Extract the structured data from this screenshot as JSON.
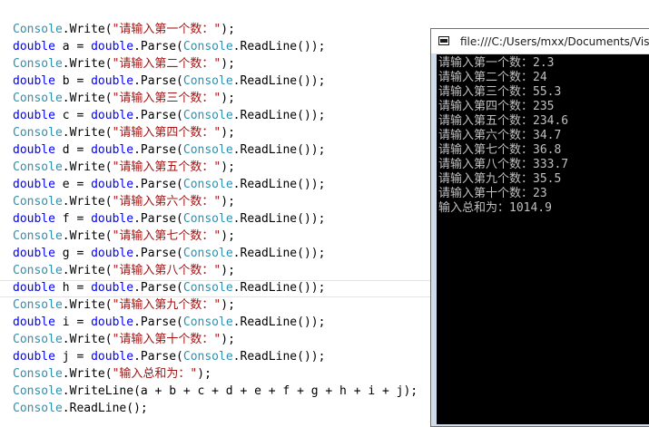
{
  "editor": {
    "lines": [
      [
        {
          "t": "cls",
          "v": "Console"
        },
        {
          "t": "plain",
          "v": ".Write("
        },
        {
          "t": "str",
          "v": "\"请输入第一个数：\""
        },
        {
          "t": "plain",
          "v": ");"
        }
      ],
      [
        {
          "t": "kw",
          "v": "double"
        },
        {
          "t": "plain",
          "v": " a = "
        },
        {
          "t": "kw",
          "v": "double"
        },
        {
          "t": "plain",
          "v": ".Parse("
        },
        {
          "t": "cls",
          "v": "Console"
        },
        {
          "t": "plain",
          "v": ".ReadLine());"
        }
      ],
      [
        {
          "t": "cls",
          "v": "Console"
        },
        {
          "t": "plain",
          "v": ".Write("
        },
        {
          "t": "str",
          "v": "\"请输入第二个数：\""
        },
        {
          "t": "plain",
          "v": ");"
        }
      ],
      [
        {
          "t": "kw",
          "v": "double"
        },
        {
          "t": "plain",
          "v": " b = "
        },
        {
          "t": "kw",
          "v": "double"
        },
        {
          "t": "plain",
          "v": ".Parse("
        },
        {
          "t": "cls",
          "v": "Console"
        },
        {
          "t": "plain",
          "v": ".ReadLine());"
        }
      ],
      [
        {
          "t": "cls",
          "v": "Console"
        },
        {
          "t": "plain",
          "v": ".Write("
        },
        {
          "t": "str",
          "v": "\"请输入第三个数：\""
        },
        {
          "t": "plain",
          "v": ");"
        }
      ],
      [
        {
          "t": "kw",
          "v": "double"
        },
        {
          "t": "plain",
          "v": " c = "
        },
        {
          "t": "kw",
          "v": "double"
        },
        {
          "t": "plain",
          "v": ".Parse("
        },
        {
          "t": "cls",
          "v": "Console"
        },
        {
          "t": "plain",
          "v": ".ReadLine());"
        }
      ],
      [
        {
          "t": "cls",
          "v": "Console"
        },
        {
          "t": "plain",
          "v": ".Write("
        },
        {
          "t": "str",
          "v": "\"请输入第四个数：\""
        },
        {
          "t": "plain",
          "v": ");"
        }
      ],
      [
        {
          "t": "kw",
          "v": "double"
        },
        {
          "t": "plain",
          "v": " d = "
        },
        {
          "t": "kw",
          "v": "double"
        },
        {
          "t": "plain",
          "v": ".Parse("
        },
        {
          "t": "cls",
          "v": "Console"
        },
        {
          "t": "plain",
          "v": ".ReadLine());"
        }
      ],
      [
        {
          "t": "cls",
          "v": "Console"
        },
        {
          "t": "plain",
          "v": ".Write("
        },
        {
          "t": "str",
          "v": "\"请输入第五个数：\""
        },
        {
          "t": "plain",
          "v": ");"
        }
      ],
      [
        {
          "t": "kw",
          "v": "double"
        },
        {
          "t": "plain",
          "v": " e = "
        },
        {
          "t": "kw",
          "v": "double"
        },
        {
          "t": "plain",
          "v": ".Parse("
        },
        {
          "t": "cls",
          "v": "Console"
        },
        {
          "t": "plain",
          "v": ".ReadLine());"
        }
      ],
      [
        {
          "t": "cls",
          "v": "Console"
        },
        {
          "t": "plain",
          "v": ".Write("
        },
        {
          "t": "str",
          "v": "\"请输入第六个数：\""
        },
        {
          "t": "plain",
          "v": ");"
        }
      ],
      [
        {
          "t": "kw",
          "v": "double"
        },
        {
          "t": "plain",
          "v": " f = "
        },
        {
          "t": "kw",
          "v": "double"
        },
        {
          "t": "plain",
          "v": ".Parse("
        },
        {
          "t": "cls",
          "v": "Console"
        },
        {
          "t": "plain",
          "v": ".ReadLine());"
        }
      ],
      [
        {
          "t": "cls",
          "v": "Console"
        },
        {
          "t": "plain",
          "v": ".Write("
        },
        {
          "t": "str",
          "v": "\"请输入第七个数：\""
        },
        {
          "t": "plain",
          "v": ");"
        }
      ],
      [
        {
          "t": "kw",
          "v": "double"
        },
        {
          "t": "plain",
          "v": " g = "
        },
        {
          "t": "kw",
          "v": "double"
        },
        {
          "t": "plain",
          "v": ".Parse("
        },
        {
          "t": "cls",
          "v": "Console"
        },
        {
          "t": "plain",
          "v": ".ReadLine());"
        }
      ],
      [
        {
          "t": "cls",
          "v": "Console"
        },
        {
          "t": "plain",
          "v": ".Write("
        },
        {
          "t": "str",
          "v": "\"请输入第八个数：\""
        },
        {
          "t": "plain",
          "v": ");"
        }
      ],
      [
        {
          "t": "kw",
          "v": "double"
        },
        {
          "t": "plain",
          "v": " h = "
        },
        {
          "t": "kw",
          "v": "double"
        },
        {
          "t": "plain",
          "v": ".Parse("
        },
        {
          "t": "cls",
          "v": "Console"
        },
        {
          "t": "plain",
          "v": ".ReadLine());"
        }
      ],
      [
        {
          "t": "cls",
          "v": "Console"
        },
        {
          "t": "plain",
          "v": ".Write("
        },
        {
          "t": "str",
          "v": "\"请输入第九个数：\""
        },
        {
          "t": "plain",
          "v": ");"
        }
      ],
      [
        {
          "t": "kw",
          "v": "double"
        },
        {
          "t": "plain",
          "v": " i = "
        },
        {
          "t": "kw",
          "v": "double"
        },
        {
          "t": "plain",
          "v": ".Parse("
        },
        {
          "t": "cls",
          "v": "Console"
        },
        {
          "t": "plain",
          "v": ".ReadLine());"
        }
      ],
      [
        {
          "t": "cls",
          "v": "Console"
        },
        {
          "t": "plain",
          "v": ".Write("
        },
        {
          "t": "str",
          "v": "\"请输入第十个数：\""
        },
        {
          "t": "plain",
          "v": ");"
        }
      ],
      [
        {
          "t": "kw",
          "v": "double"
        },
        {
          "t": "plain",
          "v": " j = "
        },
        {
          "t": "kw",
          "v": "double"
        },
        {
          "t": "plain",
          "v": ".Parse("
        },
        {
          "t": "cls",
          "v": "Console"
        },
        {
          "t": "plain",
          "v": ".ReadLine());"
        }
      ],
      [
        {
          "t": "cls",
          "v": "Console"
        },
        {
          "t": "plain",
          "v": ".Write("
        },
        {
          "t": "str",
          "v": "\"输入总和为：\""
        },
        {
          "t": "plain",
          "v": ");"
        }
      ],
      [
        {
          "t": "cls",
          "v": "Console"
        },
        {
          "t": "plain",
          "v": ".WriteLine(a + b + c + d + e + f + g + h + i + j);"
        }
      ],
      [
        {
          "t": "cls",
          "v": "Console"
        },
        {
          "t": "plain",
          "v": ".ReadLine();"
        }
      ]
    ]
  },
  "console_window": {
    "title": "file:///C:/Users/mxx/Documents/Visu",
    "output": [
      "请输入第一个数：2.3",
      "请输入第二个数：24",
      "请输入第三个数：55.3",
      "请输入第四个数：235",
      "请输入第五个数：234.6",
      "请输入第六个数：34.7",
      "请输入第七个数：36.8",
      "请输入第八个数：333.7",
      "请输入第九个数：35.5",
      "请输入第十个数：23",
      "输入总和为：1014.9"
    ]
  },
  "colors": {
    "class": "#2b91af",
    "keyword": "#0000ff",
    "string": "#a31515",
    "console_bg": "#000000",
    "console_text": "#c0c0c0"
  },
  "icons": {
    "console": "console-window-icon"
  }
}
